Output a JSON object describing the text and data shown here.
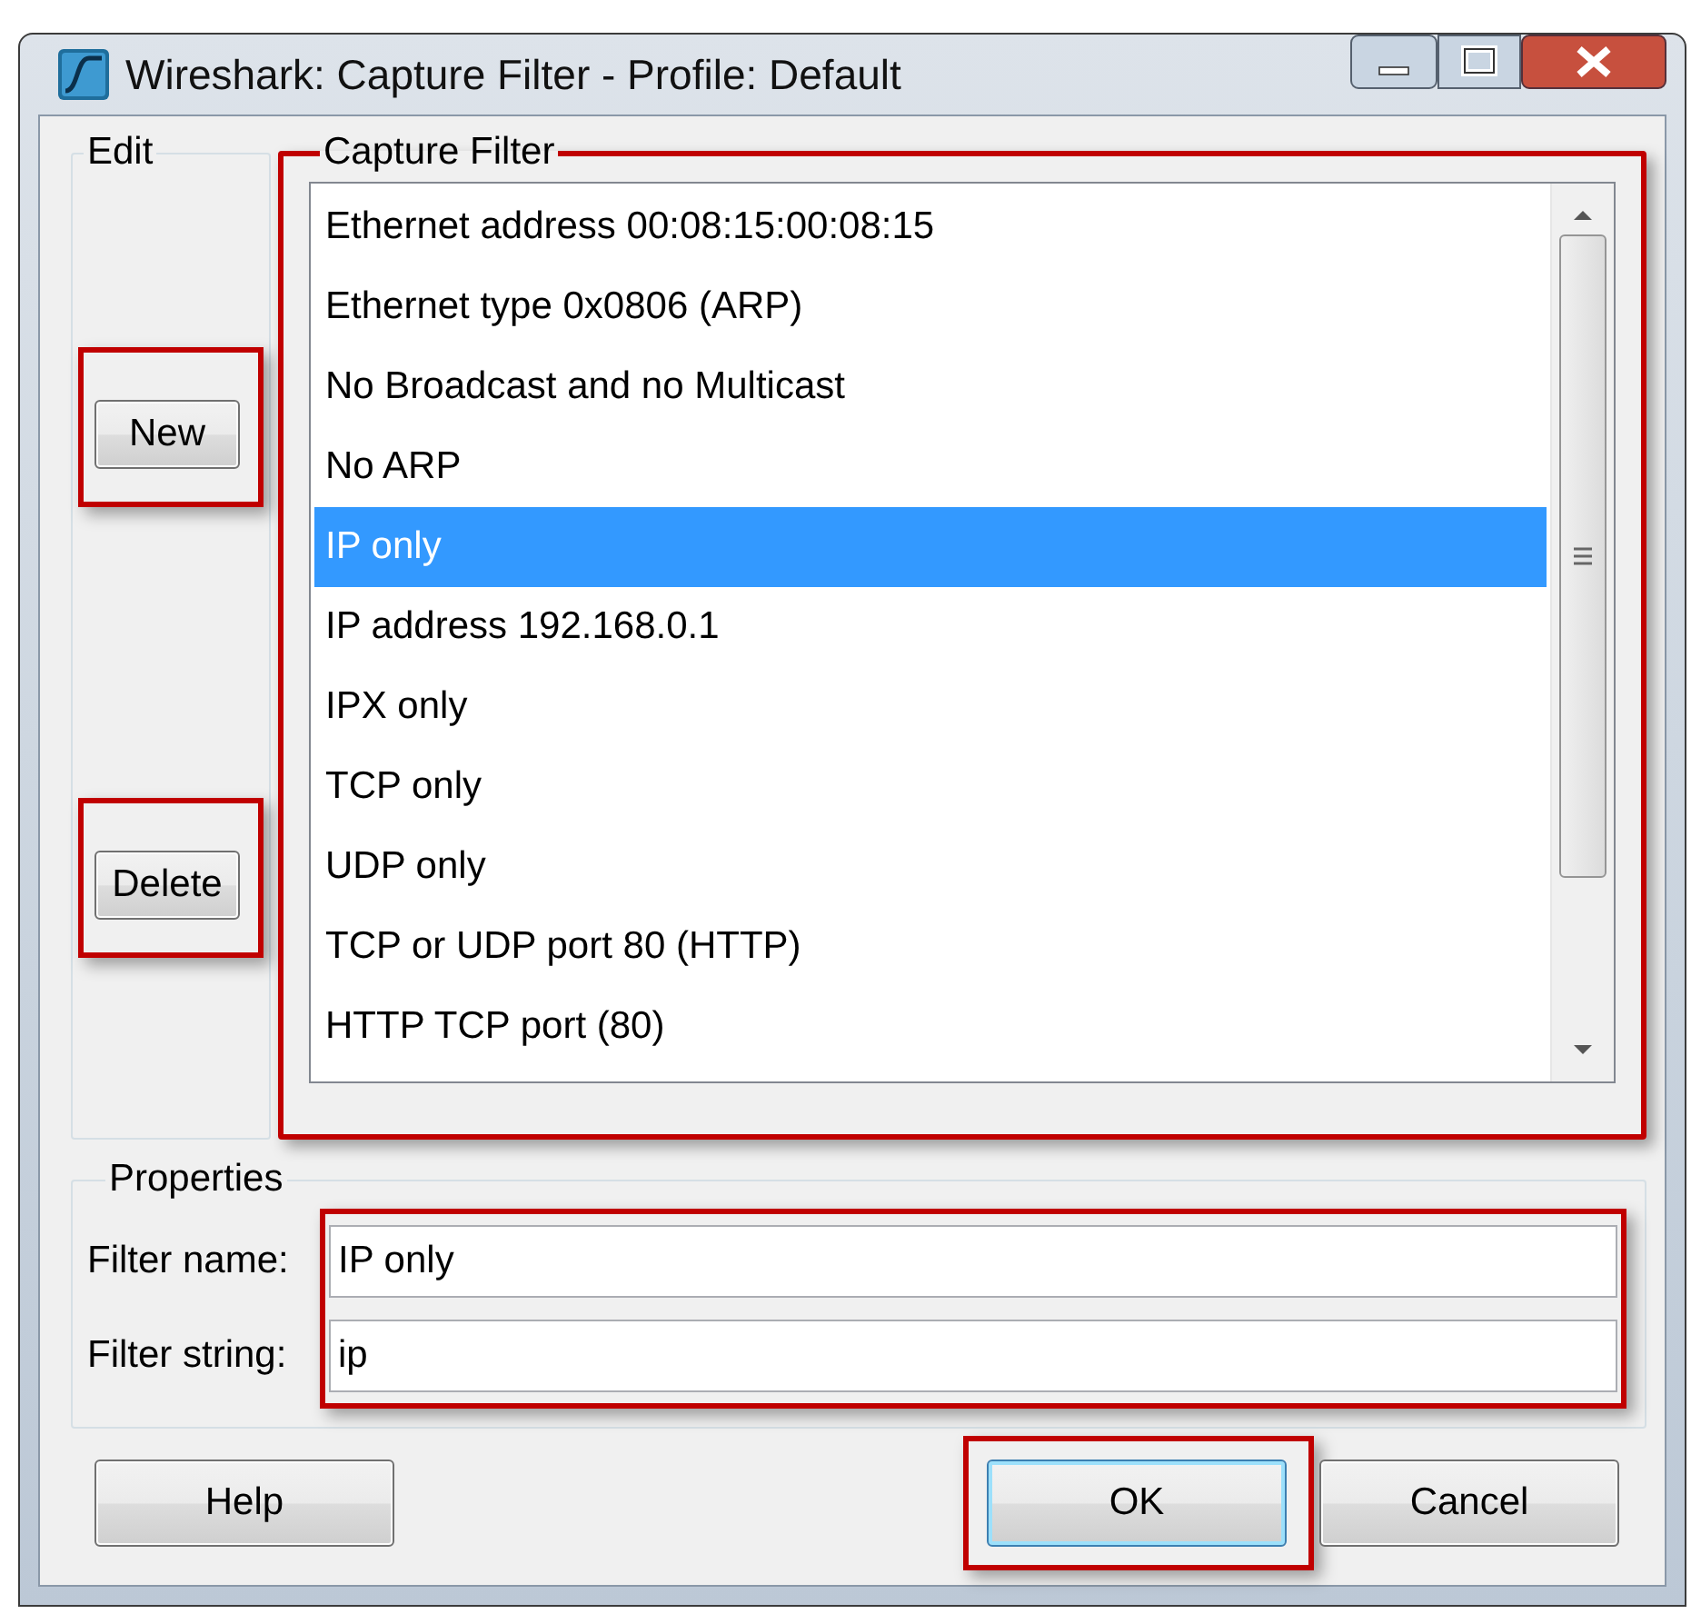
{
  "window": {
    "title": "Wireshark: Capture Filter - Profile: Default"
  },
  "edit_group": {
    "label": "Edit",
    "buttons": [
      {
        "label": "New",
        "highlighted": true
      },
      {
        "label": "Delete",
        "highlighted": true
      }
    ]
  },
  "capture_filter": {
    "label": "Capture Filter",
    "highlighted": true,
    "items": [
      {
        "label": "Ethernet address 00:08:15:00:08:15",
        "selected": false
      },
      {
        "label": "Ethernet type 0x0806 (ARP)",
        "selected": false
      },
      {
        "label": "No Broadcast and no Multicast",
        "selected": false
      },
      {
        "label": "No ARP",
        "selected": false
      },
      {
        "label": "IP only",
        "selected": true
      },
      {
        "label": "IP address 192.168.0.1",
        "selected": false
      },
      {
        "label": "IPX only",
        "selected": false
      },
      {
        "label": "TCP only",
        "selected": false
      },
      {
        "label": "UDP only",
        "selected": false
      },
      {
        "label": "TCP or UDP port 80 (HTTP)",
        "selected": false
      },
      {
        "label": "HTTP TCP port (80)",
        "selected": false
      }
    ]
  },
  "properties": {
    "label": "Properties",
    "highlighted": true,
    "fields": [
      {
        "label": "Filter name:",
        "value": "IP only"
      },
      {
        "label": "Filter string:",
        "value": "ip"
      }
    ]
  },
  "buttons": [
    {
      "label": "Help",
      "highlighted": false,
      "default": false
    },
    {
      "label": "OK",
      "highlighted": true,
      "default": true
    },
    {
      "label": "Cancel",
      "highlighted": false,
      "default": false
    }
  ]
}
